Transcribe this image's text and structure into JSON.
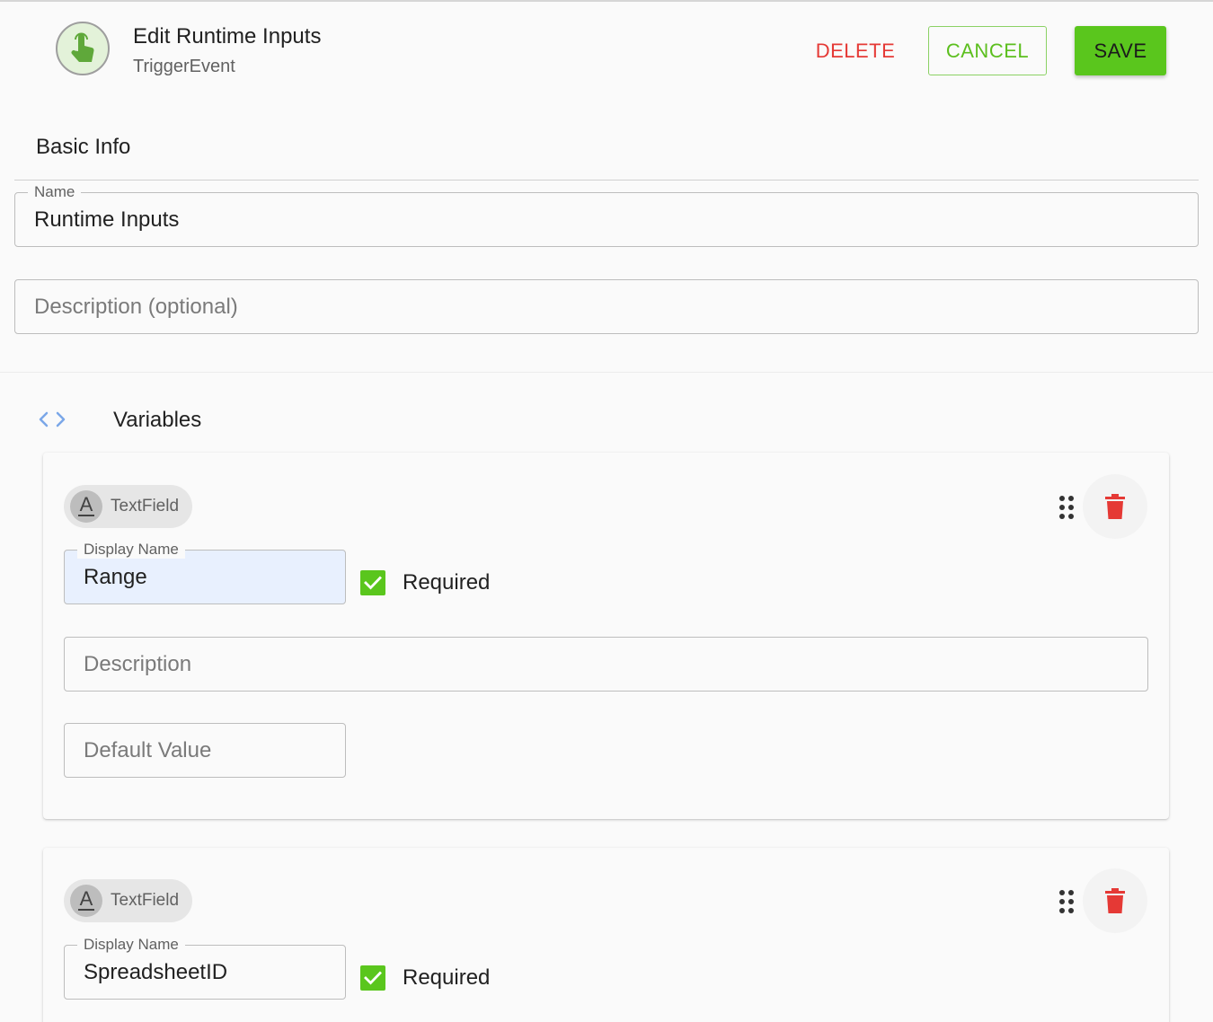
{
  "header": {
    "title": "Edit Runtime Inputs",
    "subtitle": "TriggerEvent",
    "app_icon": "touch-hand-icon",
    "delete_label": "DELETE",
    "cancel_label": "CANCEL",
    "save_label": "SAVE"
  },
  "colors": {
    "accent": "#5ac61d",
    "danger": "#e53935",
    "autofill": "#e8f0fe"
  },
  "basic_info": {
    "title": "Basic Info",
    "name_label": "Name",
    "name_value": "Runtime Inputs",
    "description_placeholder": "Description (optional)"
  },
  "variables": {
    "title": "Variables",
    "icon": "code-brackets-icon",
    "items": [
      {
        "type_label": "TextField",
        "type_icon": "text-format-icon",
        "display_name_label": "Display Name",
        "display_name_value": "Range",
        "required_label": "Required",
        "required": true,
        "description_placeholder": "Description",
        "default_value_placeholder": "Default Value"
      },
      {
        "type_label": "TextField",
        "type_icon": "text-format-icon",
        "display_name_label": "Display Name",
        "display_name_value": "SpreadsheetID",
        "required_label": "Required",
        "required": true
      }
    ]
  }
}
